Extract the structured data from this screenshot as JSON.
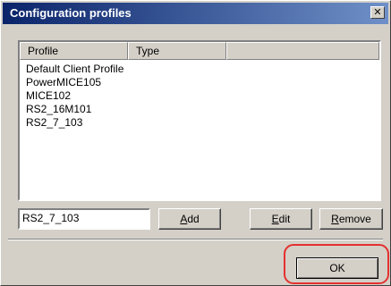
{
  "window": {
    "title": "Configuration profiles",
    "close_glyph": "✕"
  },
  "listview": {
    "columns": [
      "Profile",
      "Type",
      ""
    ],
    "rows": [
      "Default Client Profile",
      "PowerMICE105",
      "MICE102",
      "RS2_16M101",
      "RS2_7_103"
    ]
  },
  "profile_input": {
    "value": "RS2_7_103"
  },
  "buttons": {
    "add": {
      "accel": "A",
      "rest": "dd"
    },
    "edit": {
      "accel": "E",
      "rest": "dit"
    },
    "remove": {
      "accel": "R",
      "rest": "emove"
    },
    "ok": {
      "label": "OK"
    }
  },
  "colors": {
    "dialog_face": "#d4d0c8",
    "titlebar_start": "#0a246a",
    "titlebar_end": "#6f90c8",
    "highlight_ring": "#e4302f"
  }
}
